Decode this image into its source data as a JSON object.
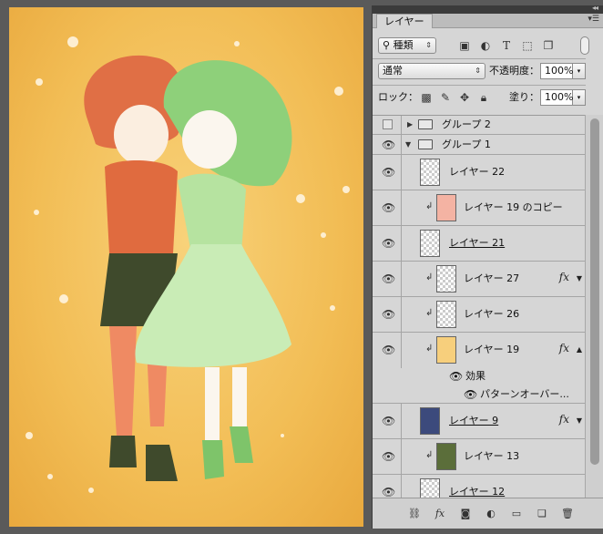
{
  "panel": {
    "tab_label": "レイヤー",
    "filter_kind": "種類",
    "blend_mode": "通常",
    "opacity_label": "不透明度：",
    "opacity_value": "100%",
    "lock_label": "ロック：",
    "fill_label": "塗り：",
    "fill_value": "100%"
  },
  "layers": [
    {
      "name": "グループ 2",
      "type": "group",
      "visible": false,
      "expanded": false
    },
    {
      "name": "グループ 1",
      "type": "group",
      "visible": true,
      "expanded": true
    },
    {
      "name": "レイヤー 22",
      "type": "layer",
      "visible": true
    },
    {
      "name": "レイヤー 19 のコピー",
      "type": "layer",
      "visible": true,
      "clipped": true,
      "thumb_color": "#f4b3a3"
    },
    {
      "name": "レイヤー 21",
      "type": "layer",
      "visible": true
    },
    {
      "name": "レイヤー 27",
      "type": "layer",
      "visible": true,
      "clipped": true,
      "fx": true
    },
    {
      "name": "レイヤー 26",
      "type": "layer",
      "visible": true,
      "clipped": true
    },
    {
      "name": "レイヤー 19",
      "type": "layer",
      "visible": true,
      "clipped": true,
      "fx": true,
      "thumb_color": "#f7cf7c"
    },
    {
      "name": "効果",
      "type": "effects"
    },
    {
      "name": "パターンオーバー...",
      "type": "effect"
    },
    {
      "name": "レイヤー 9",
      "type": "layer",
      "visible": true,
      "fx": true,
      "thumb_color": "#3c4a7c"
    },
    {
      "name": "レイヤー 13",
      "type": "layer",
      "visible": true,
      "clipped": true,
      "thumb_color": "#5b6e3a"
    },
    {
      "name": "レイヤー 12",
      "type": "layer",
      "visible": true
    }
  ],
  "bottom_icons": [
    "link-icon",
    "fx-icon",
    "mask-icon",
    "adjustment-icon",
    "new-group-icon",
    "new-layer-icon",
    "trash-icon"
  ],
  "colors": {
    "canvas_bg": "#f2bd55",
    "panel_bg": "#d6d6d6"
  }
}
